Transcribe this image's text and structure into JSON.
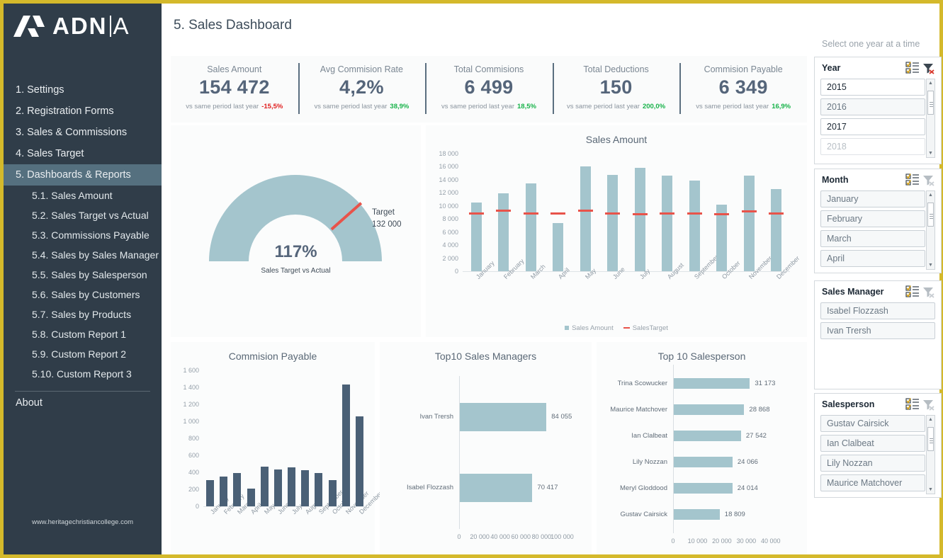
{
  "brand": {
    "name_main": "ADN",
    "name_tail": "A",
    "logo_icon": "adnia-logo-icon"
  },
  "header": {
    "title": "5. Sales Dashboard"
  },
  "footer": {
    "url": "www.heritagechristiancollege.com"
  },
  "sidebar": {
    "items": [
      {
        "label": "1. Settings",
        "active": false
      },
      {
        "label": "2. Registration Forms",
        "active": false
      },
      {
        "label": "3. Sales & Commissions",
        "active": false
      },
      {
        "label": "4. Sales Target",
        "active": false
      },
      {
        "label": "5. Dashboards & Reports",
        "active": true
      }
    ],
    "subitems": [
      {
        "label": "5.1. Sales Amount"
      },
      {
        "label": "5.2. Sales Target vs Actual"
      },
      {
        "label": "5.3. Commissions Payable"
      },
      {
        "label": "5.4. Sales by Sales Manager"
      },
      {
        "label": "5.5. Sales by Salesperson"
      },
      {
        "label": "5.6. Sales by Customers"
      },
      {
        "label": "5.7. Sales by Products"
      },
      {
        "label": "5.8. Custom Report 1"
      },
      {
        "label": "5.9. Custom Report 2"
      },
      {
        "label": "5.10. Custom Report 3"
      }
    ],
    "about": "About"
  },
  "kpis": [
    {
      "label": "Sales Amount",
      "value": "154 472",
      "foot": "vs same period last year",
      "delta": "-15,5%",
      "dir": "down"
    },
    {
      "label": "Avg Commision Rate",
      "value": "4,2%",
      "foot": "vs same period last year",
      "delta": "38,9%",
      "dir": "up"
    },
    {
      "label": "Total Commisions",
      "value": "6 499",
      "foot": "vs same period last year",
      "delta": "18,5%",
      "dir": "up"
    },
    {
      "label": "Total Deductions",
      "value": "150",
      "foot": "vs same period last year",
      "delta": "200,0%",
      "dir": "up"
    },
    {
      "label": "Commision Payable",
      "value": "6 349",
      "foot": "vs same period last year",
      "delta": "16,9%",
      "dir": "up"
    }
  ],
  "slicer_hint": "Select one year at a time",
  "slicers": [
    {
      "title": "Year",
      "multiselect_icon": "multiselect-icon",
      "clear_icon": "clear-filter-icon",
      "clear_active": true,
      "scrollbar": true,
      "items": [
        {
          "label": "2015",
          "state": "unsel"
        },
        {
          "label": "2016",
          "state": "sel"
        },
        {
          "label": "2017",
          "state": "unsel"
        },
        {
          "label": "2018",
          "state": "dim"
        }
      ]
    },
    {
      "title": "Month",
      "multiselect_icon": "multiselect-icon",
      "clear_icon": "clear-filter-icon",
      "clear_active": false,
      "scrollbar": true,
      "items": [
        {
          "label": "January",
          "state": "sel"
        },
        {
          "label": "February",
          "state": "sel"
        },
        {
          "label": "March",
          "state": "sel"
        },
        {
          "label": "April",
          "state": "sel"
        }
      ]
    },
    {
      "title": "Sales Manager",
      "multiselect_icon": "multiselect-icon",
      "clear_icon": "clear-filter-icon",
      "clear_active": false,
      "scrollbar": false,
      "items": [
        {
          "label": "Isabel Flozzash",
          "state": "sel"
        },
        {
          "label": "Ivan Trersh",
          "state": "sel"
        }
      ]
    },
    {
      "title": "Salesperson",
      "multiselect_icon": "multiselect-icon",
      "clear_icon": "clear-filter-icon",
      "clear_active": false,
      "scrollbar": true,
      "items": [
        {
          "label": "Gustav Cairsick",
          "state": "sel"
        },
        {
          "label": "Ian Clalbeat",
          "state": "sel"
        },
        {
          "label": "Lily Nozzan",
          "state": "sel"
        },
        {
          "label": "Maurice Matchover",
          "state": "sel"
        }
      ]
    }
  ],
  "colors": {
    "bar_light": "#a4c5cd",
    "bar_dark": "#4a6076",
    "target_red": "#e8534a",
    "sidebar": "#303d49",
    "accent_yellow": "#d4b92b",
    "kpi_value": "#55657a",
    "delta_up": "#18b34a",
    "delta_down": "#e02020"
  },
  "chart_data": [
    {
      "type": "gauge",
      "title": "Sales Target vs Actual",
      "value_label": "117%",
      "value_pct": 117,
      "target_label": "Target",
      "target_value": "132 000",
      "target_pct": 100,
      "scale_max": 130
    },
    {
      "type": "bar",
      "title": "Sales Amount",
      "categories": [
        "January",
        "February",
        "March",
        "April",
        "May",
        "June",
        "July",
        "August",
        "September",
        "October",
        "November",
        "December"
      ],
      "series": [
        {
          "name": "Sales Amount",
          "values": [
            10550,
            11900,
            13450,
            7350,
            16000,
            14800,
            15800,
            14600,
            13900,
            10200,
            14600,
            12600
          ]
        },
        {
          "name": "SalesTarget",
          "values": [
            9000,
            9400,
            9000,
            9050,
            9450,
            8950,
            8900,
            9050,
            9000,
            8900,
            9350,
            8950
          ]
        }
      ],
      "legend": [
        "Sales Amount",
        "SalesTarget"
      ],
      "legend_position": "bottom",
      "ylim": [
        0,
        18000
      ],
      "yticks": [
        "0",
        "2 000",
        "4 000",
        "6 000",
        "8 000",
        "10 000",
        "12 000",
        "14 000",
        "16 000",
        "18 000"
      ],
      "xlabel": "",
      "ylabel": "",
      "grid": false
    },
    {
      "type": "bar",
      "title": "Commision Payable",
      "categories": [
        "January",
        "February",
        "March",
        "April",
        "May",
        "June",
        "July",
        "August",
        "September",
        "October",
        "November",
        "December"
      ],
      "values": [
        310,
        350,
        395,
        210,
        470,
        435,
        460,
        425,
        395,
        305,
        1435,
        1060
      ],
      "ylim": [
        0,
        1600
      ],
      "yticks": [
        "0",
        "200",
        "400",
        "600",
        "800",
        "1 000",
        "1 200",
        "1 400",
        "1 600"
      ],
      "xlabel": "",
      "ylabel": "",
      "grid": false
    },
    {
      "type": "bar",
      "orientation": "horizontal",
      "title": "Top10 Sales Managers",
      "categories": [
        "Ivan Trersh",
        "Isabel Flozzash"
      ],
      "values": [
        84055,
        70417
      ],
      "value_labels": [
        "84 055",
        "70 417"
      ],
      "xlim": [
        0,
        110000
      ],
      "xticks": [
        "0",
        "20 000",
        "40 000",
        "60 000",
        "80 000",
        "100 000"
      ],
      "xtick_values": [
        0,
        20000,
        40000,
        60000,
        80000,
        100000
      ]
    },
    {
      "type": "bar",
      "orientation": "horizontal",
      "title": "Top 10 Salesperson",
      "categories": [
        "Trina Scowucker",
        "Maurice Matchover",
        "Ian Clalbeat",
        "Lily Nozzan",
        "Meryl Gloddood",
        "Gustav Cairsick"
      ],
      "values": [
        31173,
        28868,
        27542,
        24066,
        24014,
        18809
      ],
      "value_labels": [
        "31 173",
        "28 868",
        "27 542",
        "24 066",
        "24 014",
        "18 809"
      ],
      "xlim": [
        0,
        45000
      ],
      "xticks": [
        "0",
        "10 000",
        "20 000",
        "30 000",
        "40 000"
      ],
      "xtick_values": [
        0,
        10000,
        20000,
        30000,
        40000
      ]
    }
  ]
}
